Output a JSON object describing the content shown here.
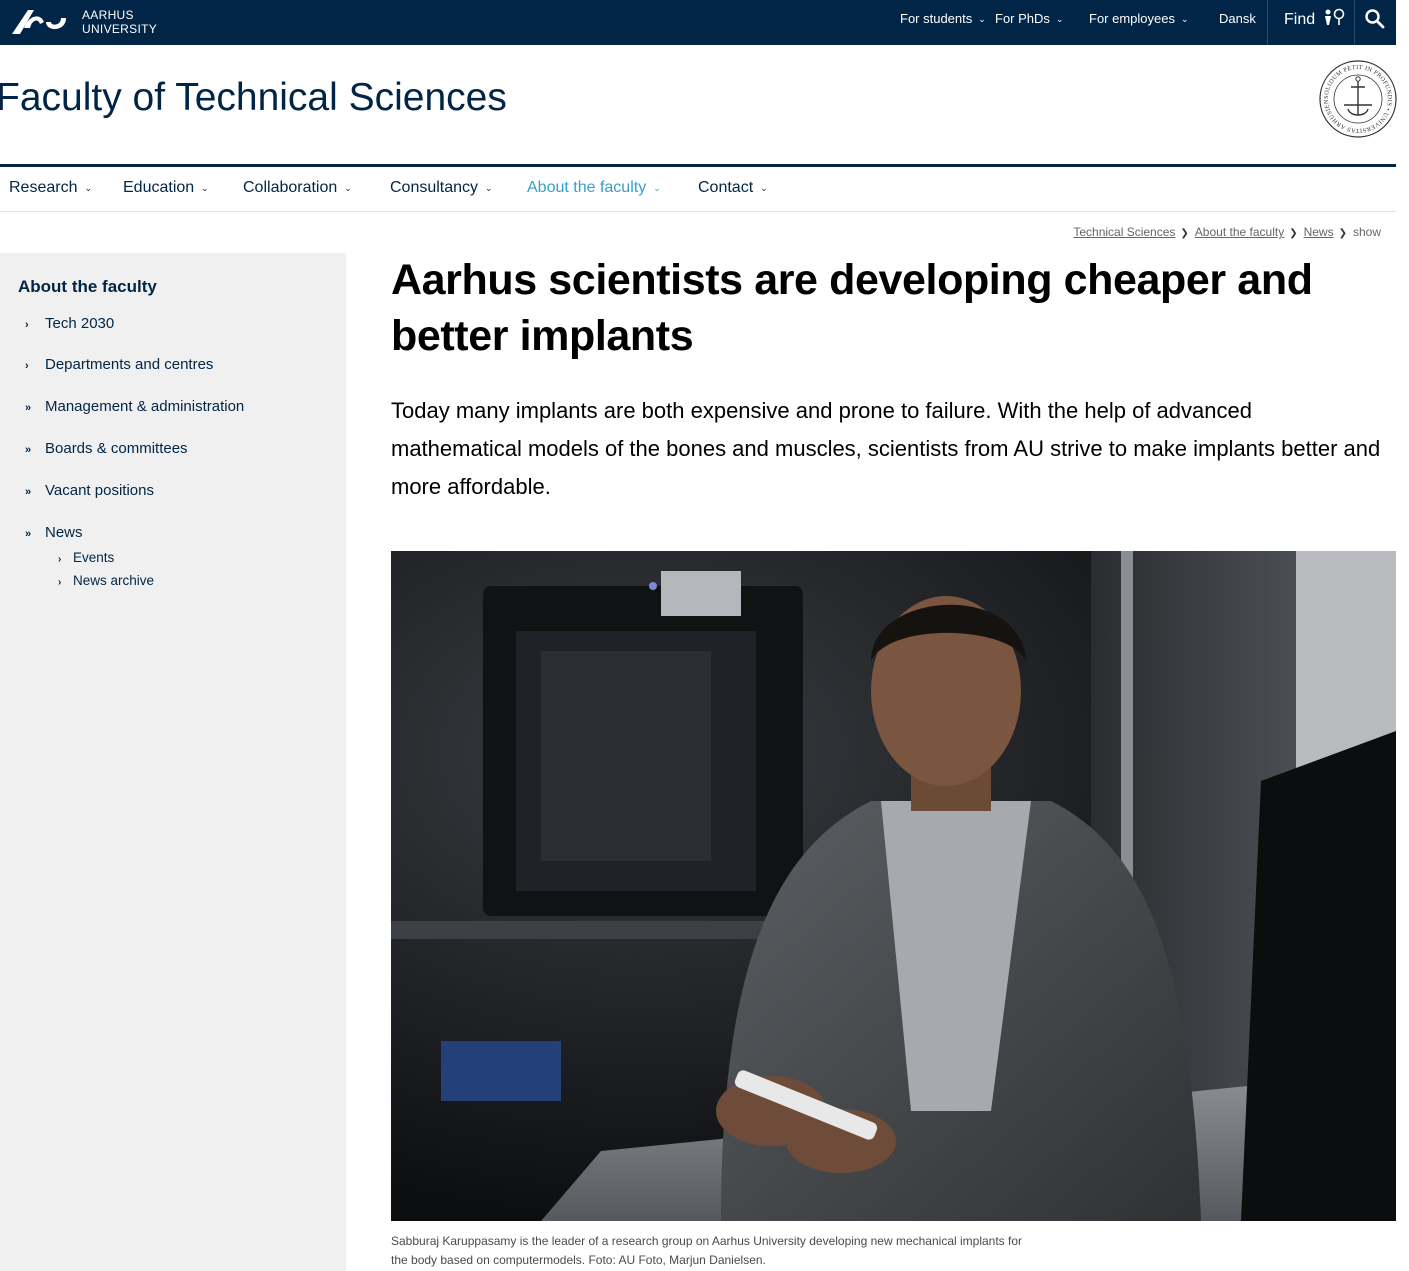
{
  "topbar": {
    "logo": {
      "line1": "AARHUS",
      "line2": "UNIVERSITY"
    },
    "links": [
      {
        "label": "For students",
        "icon": "chevron-down-icon"
      },
      {
        "label": "For PhDs",
        "icon": "chevron-down-icon"
      },
      {
        "label": "For employees",
        "icon": "chevron-down-icon"
      },
      {
        "label": "Dansk"
      }
    ],
    "find_label": "Find",
    "find_icon": "map-pin-icon",
    "search_icon": "search-icon"
  },
  "header": {
    "faculty_title": "Faculty of Technical Sciences",
    "seal_text": "SOLIDUM PETIT IN PROFUNDIS • UNIVERSITAS ARHUSIENSIS"
  },
  "main_nav": [
    {
      "label": "Research"
    },
    {
      "label": "Education"
    },
    {
      "label": "Collaboration"
    },
    {
      "label": "Consultancy"
    },
    {
      "label": "About the faculty",
      "active": true
    },
    {
      "label": "Contact"
    }
  ],
  "breadcrumb": [
    "Technical Sciences",
    "About the faculty",
    "News",
    "show"
  ],
  "sidebar": {
    "title": "About the faculty",
    "items": [
      {
        "label": "Tech 2030",
        "marker": "›"
      },
      {
        "label": "Departments and centres",
        "marker": "›"
      },
      {
        "label": "Management & administration",
        "marker": "»"
      },
      {
        "label": "Boards & committees",
        "marker": "»"
      },
      {
        "label": "Vacant positions",
        "marker": "»"
      },
      {
        "label": "News",
        "marker": "»"
      }
    ],
    "subitems": [
      {
        "label": "Events",
        "marker": "›"
      },
      {
        "label": "News archive",
        "marker": "›"
      }
    ]
  },
  "article": {
    "headline": "Aarhus scientists are developing cheaper and better implants",
    "lead": "Today many implants are both expensive and prone to failure. With the help of advanced mathematical models of the bones and muscles, scientists from AU strive to make implants better and more affordable.",
    "image_alt": "Man in grey suit holding a small implant in a lab with a 3D printer",
    "caption": "Sabburaj Karuppasamy is the leader of a research group on Aarhus University developing new mechanical implants for the body based on computermodels. Foto: AU Foto, Marjun Danielsen."
  },
  "colors": {
    "brand_navy": "#002546",
    "accent_blue": "#379fcb",
    "sidebar_bg": "#f0f0f0"
  }
}
